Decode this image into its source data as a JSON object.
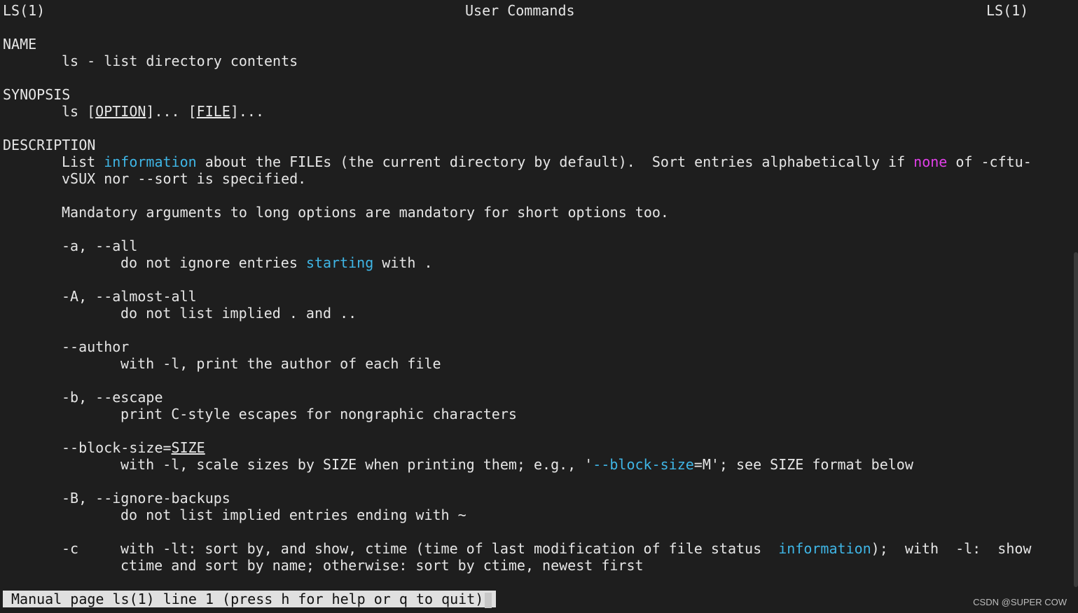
{
  "header": {
    "left": "LS(1)",
    "center": "User Commands",
    "right": "LS(1)"
  },
  "sections": {
    "name_heading": "NAME",
    "name_text": "ls - list directory contents",
    "synopsis_heading": "SYNOPSIS",
    "synopsis": {
      "cmd": "ls ",
      "bracket_open1": "[",
      "option": "OPTION",
      "rest1": "]... [",
      "file": "FILE",
      "rest2": "]..."
    },
    "description_heading": "DESCRIPTION",
    "desc_line1": {
      "a": "List ",
      "b": "information",
      "c": " about the FILEs (the current directory by default).  Sort entries alphabetically if ",
      "d": "none",
      "e": " of -cftu-"
    },
    "desc_line2": "vSUX nor --sort is specified.",
    "mandatory": "Mandatory arguments to long options are mandatory for short options too."
  },
  "options": {
    "a_flag": "-a, --all",
    "a_desc": {
      "a": "do not ignore entries ",
      "b": "starting",
      "c": " with ."
    },
    "A_flag": "-A, --almost-all",
    "A_desc": "do not list implied . and ..",
    "author_flag": "--author",
    "author_desc": "with -l, print the author of each file",
    "b_flag": "-b, --escape",
    "b_desc": "print C-style escapes for nongraphic characters",
    "block_flag": {
      "a": "--block-size=",
      "b": "SIZE"
    },
    "block_desc": {
      "a": "with -l, scale sizes by SIZE when printing them; e.g., '",
      "b": "--block-size",
      "c": "=M'; see SIZE format below"
    },
    "B_flag": "-B, --ignore-backups",
    "B_desc": "do not list implied entries ending with ~",
    "c_flag": "-c",
    "c_desc1": {
      "a": "with -lt: sort by, and show, ctime (time of last modification of file status  ",
      "b": "information",
      "c": ");  with  -l:  show"
    },
    "c_desc2": "ctime and sort by name; otherwise: sort by ctime, newest first"
  },
  "status_bar": "Manual page ls(1) line 1 (press h for help or q to quit)",
  "watermark": "CSDN @SUPER COW",
  "colors": {
    "background": "#1e1e1e",
    "text": "#e6e6e6",
    "cyan": "#3fb6e6",
    "magenta": "#e040e8"
  }
}
